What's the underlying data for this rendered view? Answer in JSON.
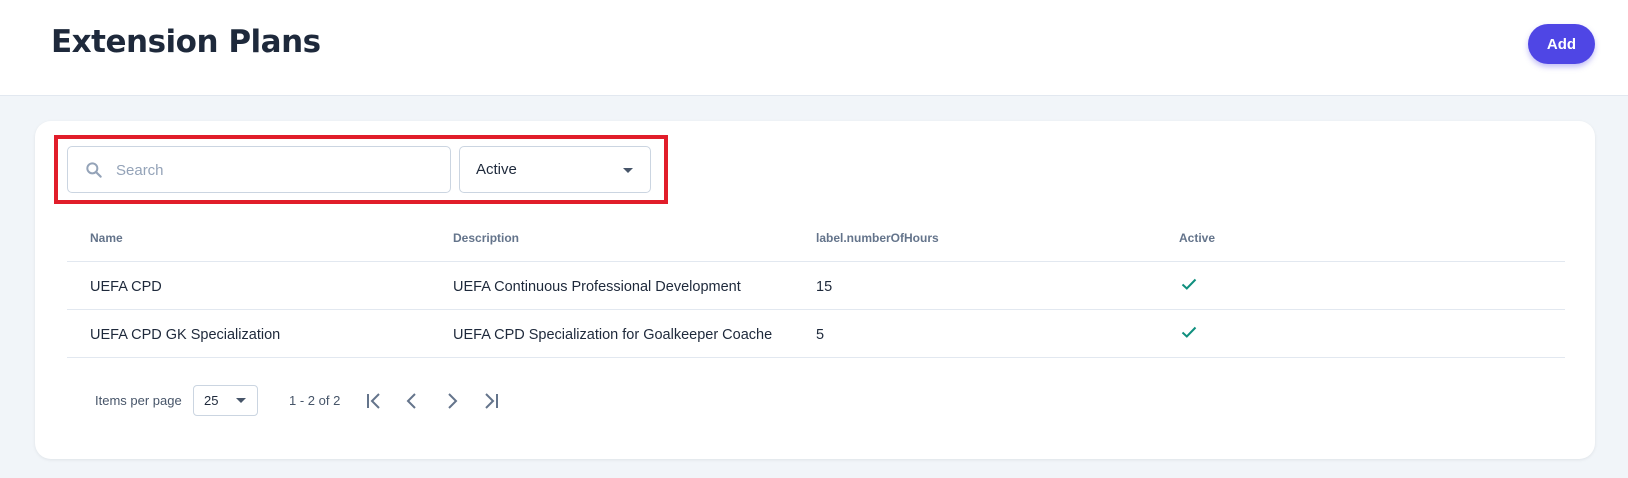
{
  "header": {
    "title": "Extension Plans",
    "add_label": "Add"
  },
  "filters": {
    "search_placeholder": "Search",
    "search_value": "",
    "status_value": "Active"
  },
  "table": {
    "columns": [
      "Name",
      "Description",
      "label.numberOfHours",
      "Active"
    ],
    "rows": [
      {
        "name": "UEFA CPD",
        "description": "UEFA Continuous Professional Development",
        "hours": "15",
        "active": true
      },
      {
        "name": "UEFA CPD GK Specialization",
        "description": "UEFA CPD Specialization for Goalkeeper Coache",
        "hours": "5",
        "active": true
      }
    ]
  },
  "pagination": {
    "items_per_page_label": "Items per page",
    "page_size": "25",
    "range": "1 - 2 of 2"
  },
  "icons": {
    "search": "search-icon",
    "dropdown": "chevron-down-icon",
    "check": "check-icon",
    "first_page": "first-page-icon",
    "prev_page": "chevron-left-icon",
    "next_page": "chevron-right-icon",
    "last_page": "last-page-icon"
  },
  "colors": {
    "accent": "#4f46e5",
    "check": "#0f8f7e",
    "highlight": "#e11d2a"
  }
}
